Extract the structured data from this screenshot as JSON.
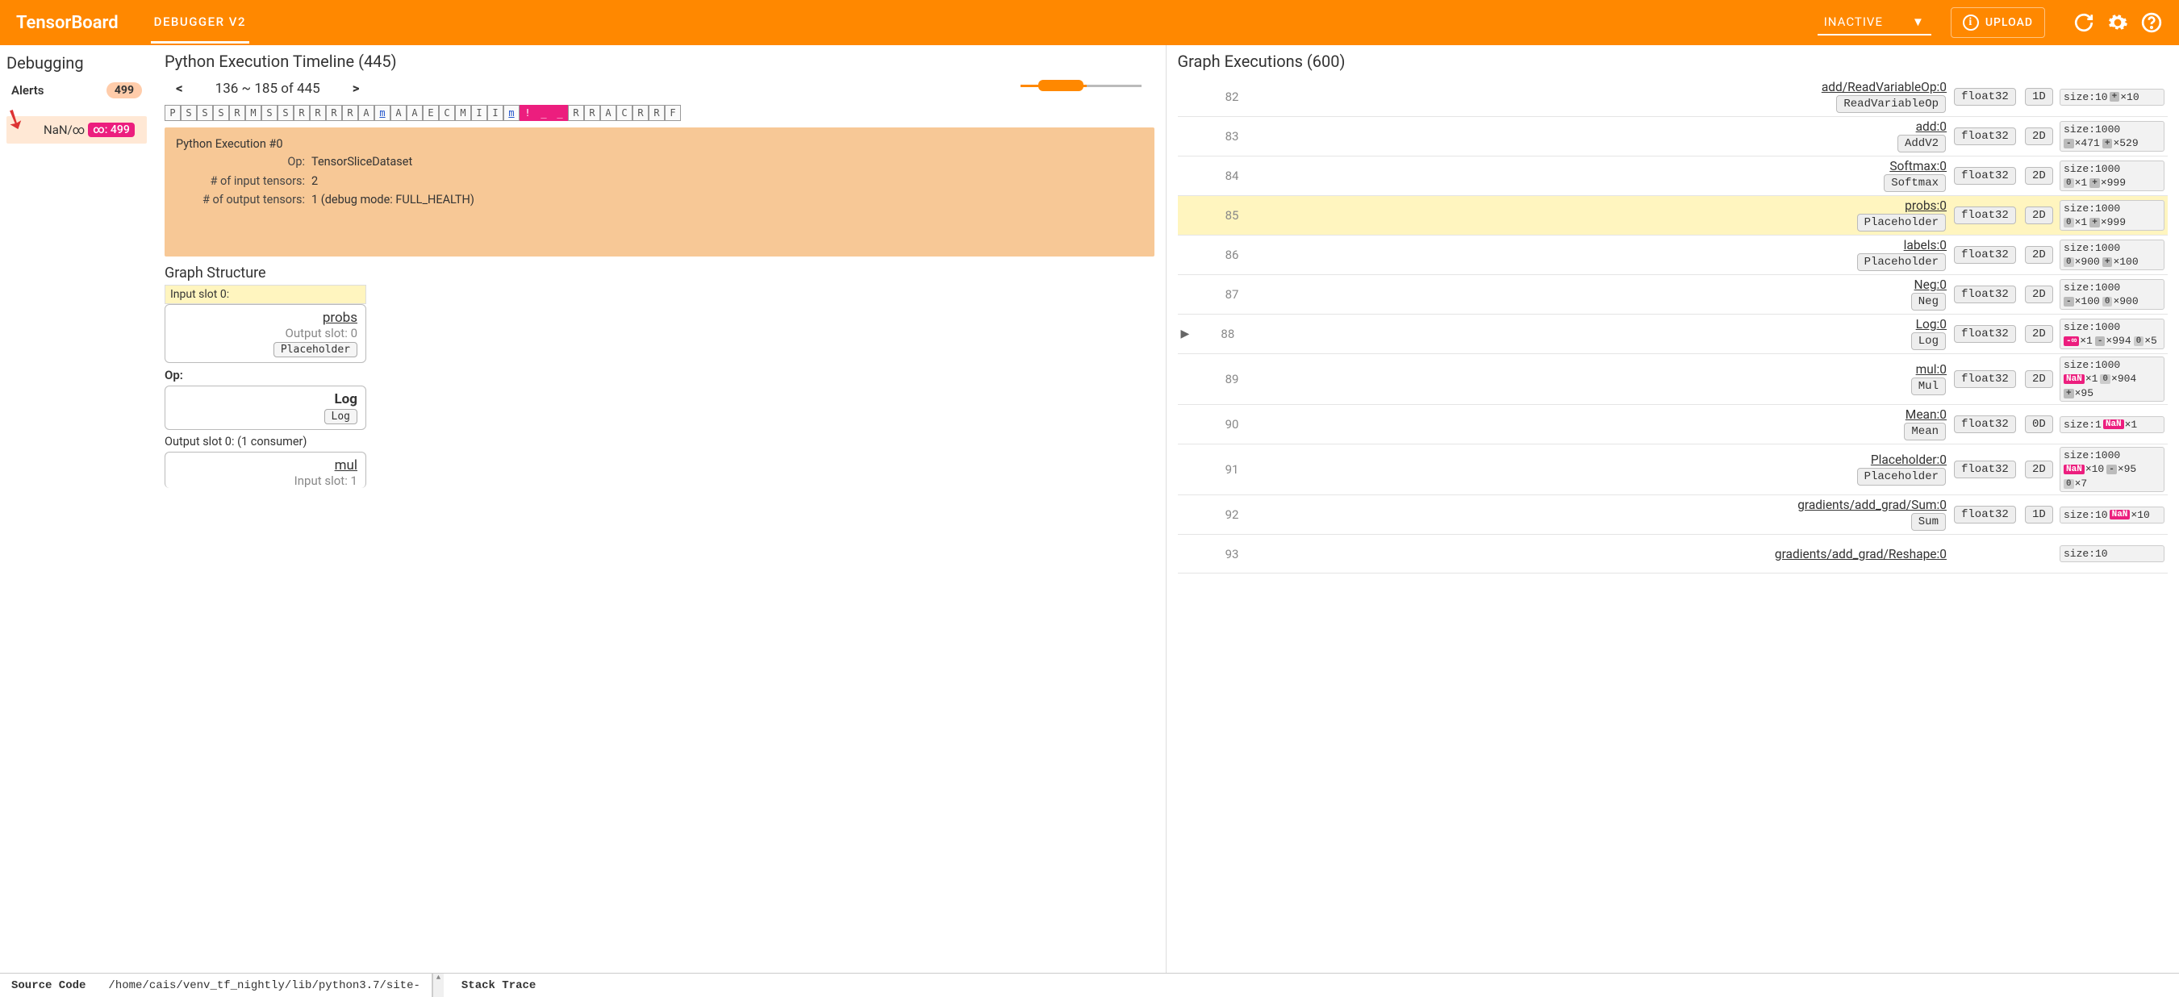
{
  "header": {
    "brand": "TensorBoard",
    "active_tab": "DEBUGGER V2",
    "mode_select": "INACTIVE",
    "upload": "UPLOAD"
  },
  "sidebar": {
    "title": "Debugging",
    "alerts_label": "Alerts",
    "alerts_count": "499",
    "alert_item_label": "NaN/∞",
    "alert_item_value": "∞: 499"
  },
  "timeline": {
    "title": "Python Execution Timeline (445)",
    "prev": "<",
    "range": "136 ~ 185 of 445",
    "next": ">",
    "cells": [
      {
        "t": "P"
      },
      {
        "t": "S"
      },
      {
        "t": "S"
      },
      {
        "t": "S"
      },
      {
        "t": "R"
      },
      {
        "t": "M"
      },
      {
        "t": "S"
      },
      {
        "t": "S"
      },
      {
        "t": "R"
      },
      {
        "t": "R"
      },
      {
        "t": "R"
      },
      {
        "t": "R"
      },
      {
        "t": "A"
      },
      {
        "t": "m",
        "cls": "u"
      },
      {
        "t": "A"
      },
      {
        "t": "A"
      },
      {
        "t": "E"
      },
      {
        "t": "C"
      },
      {
        "t": "M"
      },
      {
        "t": "I"
      },
      {
        "t": "I"
      },
      {
        "t": "m",
        "cls": "u"
      },
      {
        "t": "!",
        "cls": "hot"
      },
      {
        "t": "_",
        "cls": "hot"
      },
      {
        "t": "_",
        "cls": "hot"
      },
      {
        "t": "R"
      },
      {
        "t": "R"
      },
      {
        "t": "A"
      },
      {
        "t": "C"
      },
      {
        "t": "R"
      },
      {
        "t": "R"
      },
      {
        "t": "F"
      }
    ],
    "exec": {
      "heading": "Python Execution #0",
      "op_label": "Op:",
      "op": "TensorSliceDataset",
      "in_label": "# of input tensors:",
      "in": "2",
      "out_label": "# of output tensors:",
      "out": "1   (debug mode: FULL_HEALTH)"
    }
  },
  "graph_structure": {
    "title": "Graph Structure",
    "input_slot": "Input slot 0:",
    "input": {
      "name": "probs",
      "meta": "Output slot: 0",
      "op": "Placeholder"
    },
    "op_label": "Op:",
    "op": {
      "name": "Log",
      "pill": "Log"
    },
    "output_slot": "Output slot 0: (1 consumer)",
    "output": {
      "name": "mul",
      "meta": "Input slot: 1"
    }
  },
  "graph_exec": {
    "title": "Graph Executions (600)",
    "rows": [
      {
        "idx": "82",
        "name": "add/ReadVariableOp:0",
        "op": "ReadVariableOp",
        "dtype": "float32",
        "shape": "1D",
        "size": "size:10",
        "stats": [
          {
            "tag": "pos",
            "txt": "+",
            "v": "×10"
          }
        ]
      },
      {
        "idx": "83",
        "name": "add:0",
        "op": "AddV2",
        "dtype": "float32",
        "shape": "2D",
        "size": "size:1000",
        "stats": [
          {
            "tag": "neg",
            "txt": "-",
            "v": "×471"
          },
          {
            "tag": "pos",
            "txt": "+",
            "v": "×529"
          }
        ]
      },
      {
        "idx": "84",
        "name": "Softmax:0",
        "op": "Softmax",
        "dtype": "float32",
        "shape": "2D",
        "size": "size:1000",
        "stats": [
          {
            "tag": "zero",
            "txt": "0",
            "v": "×1"
          },
          {
            "tag": "pos",
            "txt": "+",
            "v": "×999"
          }
        ]
      },
      {
        "idx": "85",
        "name": "probs:0",
        "op": "Placeholder",
        "dtype": "float32",
        "shape": "2D",
        "size": "size:1000",
        "stats": [
          {
            "tag": "zero",
            "txt": "0",
            "v": "×1"
          },
          {
            "tag": "pos",
            "txt": "+",
            "v": "×999"
          }
        ],
        "hl": true
      },
      {
        "idx": "86",
        "name": "labels:0",
        "op": "Placeholder",
        "dtype": "float32",
        "shape": "2D",
        "size": "size:1000",
        "stats": [
          {
            "tag": "zero",
            "txt": "0",
            "v": "×900"
          },
          {
            "tag": "pos",
            "txt": "+",
            "v": "×100"
          }
        ]
      },
      {
        "idx": "87",
        "name": "Neg:0",
        "op": "Neg",
        "dtype": "float32",
        "shape": "2D",
        "size": "size:1000",
        "stats": [
          {
            "tag": "neg",
            "txt": "-",
            "v": "×100"
          },
          {
            "tag": "zero",
            "txt": "0",
            "v": "×900"
          }
        ]
      },
      {
        "idx": "88",
        "name": "Log:0",
        "op": "Log",
        "dtype": "float32",
        "shape": "2D",
        "size": "size:1000",
        "stats": [
          {
            "tag": "neginf",
            "txt": "-∞",
            "v": "×1"
          },
          {
            "tag": "neg",
            "txt": "-",
            "v": "×994"
          },
          {
            "tag": "zero",
            "txt": "0",
            "v": "×5"
          }
        ],
        "play": true
      },
      {
        "idx": "89",
        "name": "mul:0",
        "op": "Mul",
        "dtype": "float32",
        "shape": "2D",
        "size": "size:1000",
        "stats": [
          {
            "tag": "nan",
            "txt": "NaN",
            "v": "×1"
          },
          {
            "tag": "zero",
            "txt": "0",
            "v": "×904"
          },
          {
            "tag": "pos",
            "txt": "+",
            "v": "×95"
          }
        ]
      },
      {
        "idx": "90",
        "name": "Mean:0",
        "op": "Mean",
        "dtype": "float32",
        "shape": "0D",
        "size": "size:1",
        "stats": [
          {
            "tag": "nan",
            "txt": "NaN",
            "v": "×1"
          }
        ]
      },
      {
        "idx": "91",
        "name": "Placeholder:0",
        "op": "Placeholder",
        "dtype": "float32",
        "shape": "2D",
        "size": "size:1000",
        "stats": [
          {
            "tag": "nan",
            "txt": "NaN",
            "v": "×10"
          },
          {
            "tag": "neg",
            "txt": "-",
            "v": "×95"
          },
          {
            "tag": "zero",
            "txt": "0",
            "v": "×7"
          }
        ]
      },
      {
        "idx": "92",
        "name": "gradients/add_grad/Sum:0",
        "op": "Sum",
        "dtype": "float32",
        "shape": "1D",
        "size": "size:10",
        "stats": [
          {
            "tag": "nan",
            "txt": "NaN",
            "v": "×10"
          }
        ]
      },
      {
        "idx": "93",
        "name": "gradients/add_grad/Reshape:0",
        "op": "",
        "dtype": "",
        "shape": "",
        "size": "size:10",
        "stats": []
      }
    ]
  },
  "footer": {
    "source_label": "Source Code",
    "source_path": "/home/cais/venv_tf_nightly/lib/python3.7/site-",
    "stack_label": "Stack Trace"
  }
}
